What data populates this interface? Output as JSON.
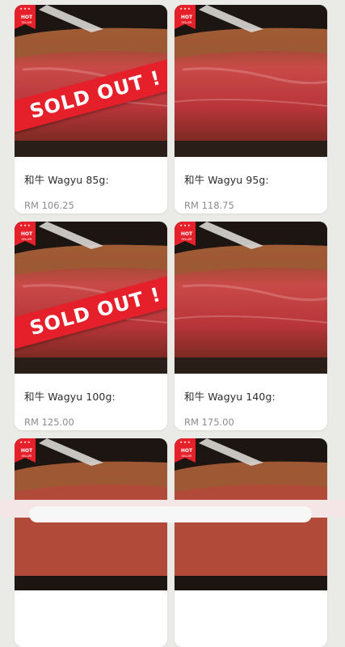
{
  "products": [
    {
      "name": "和牛 Wagyu 85g:",
      "price": "RM 106.25",
      "sold_out": true
    },
    {
      "name": "和牛 Wagyu 95g:",
      "price": "RM 118.75",
      "sold_out": false
    },
    {
      "name": "和牛 Wagyu 100g:",
      "price": "RM 125.00",
      "sold_out": true
    },
    {
      "name": "和牛 Wagyu 140g:",
      "price": "RM 175.00",
      "sold_out": false
    },
    {
      "name": "",
      "price": "",
      "sold_out": false
    },
    {
      "name": "",
      "price": "",
      "sold_out": false
    }
  ],
  "badges": {
    "sold_out_label": "SOLD OUT !",
    "hot_label": "HOT",
    "hot_sub_label": "SELLER"
  },
  "colors": {
    "badge_red": "#e6202a",
    "card_bg": "#ffffff",
    "page_bg": "#eaeae7"
  },
  "icons": {
    "hot_badge": "hot-seller-ribbon-icon"
  }
}
